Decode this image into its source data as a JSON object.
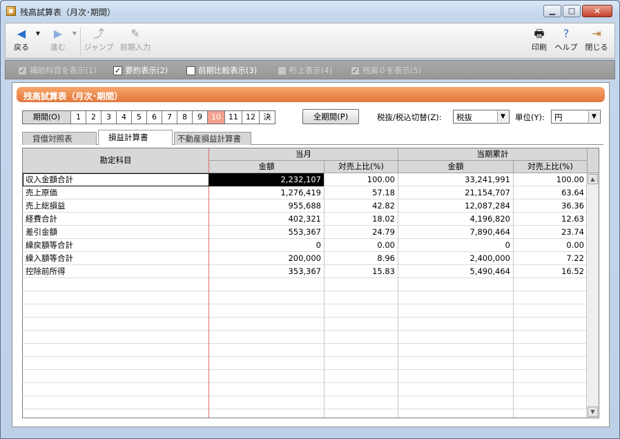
{
  "window": {
    "title": "残高試算表（月次･期間）"
  },
  "toolbar": {
    "back": "戻る",
    "forward": "進む",
    "jump": "ジャンプ",
    "prev_input": "前期入力",
    "print": "印刷",
    "help": "ヘルプ",
    "close": "閉じる"
  },
  "options": [
    {
      "label": "補助科目を表示(1)",
      "checked": true,
      "enabled": false
    },
    {
      "label": "要約表示(2)",
      "checked": true,
      "enabled": true
    },
    {
      "label": "前期比較表示(3)",
      "checked": false,
      "enabled": true
    },
    {
      "label": "桁上表示(4)",
      "checked": false,
      "enabled": false
    },
    {
      "label": "残高０を表示(5)",
      "checked": true,
      "enabled": false
    }
  ],
  "panel": {
    "header": "残高試算表（月次･期間）",
    "period_label": "期間(O)",
    "periods": [
      "1",
      "2",
      "3",
      "4",
      "5",
      "6",
      "7",
      "8",
      "9",
      "10",
      "11",
      "12",
      "決"
    ],
    "active_period": "10",
    "all_period_button": "全期間(P)",
    "tax_label": "税抜/税込切替(Z):",
    "tax_value": "税抜",
    "unit_label": "単位(Y):",
    "unit_value": "円"
  },
  "tabs": [
    {
      "label": "貸借対照表",
      "active": false
    },
    {
      "label": "損益計算書",
      "active": true
    },
    {
      "label": "不動産損益計算書",
      "active": false
    }
  ],
  "table": {
    "col_account": "勘定科目",
    "group_month": "当月",
    "group_cumulative": "当期累計",
    "col_amount": "金額",
    "col_ratio": "対売上比(%)",
    "rows": [
      {
        "account": "収入金額合計",
        "m_amount": "2,232,107",
        "m_ratio": "100.00",
        "c_amount": "33,241,991",
        "c_ratio": "100.00"
      },
      {
        "account": "売上原価",
        "m_amount": "1,276,419",
        "m_ratio": "57.18",
        "c_amount": "21,154,707",
        "c_ratio": "63.64"
      },
      {
        "account": "売上総損益",
        "m_amount": "955,688",
        "m_ratio": "42.82",
        "c_amount": "12,087,284",
        "c_ratio": "36.36"
      },
      {
        "account": "経費合計",
        "m_amount": "402,321",
        "m_ratio": "18.02",
        "c_amount": "4,196,820",
        "c_ratio": "12.63"
      },
      {
        "account": "差引金額",
        "m_amount": "553,367",
        "m_ratio": "24.79",
        "c_amount": "7,890,464",
        "c_ratio": "23.74"
      },
      {
        "account": "繰戻額等合計",
        "m_amount": "0",
        "m_ratio": "0.00",
        "c_amount": "0",
        "c_ratio": "0.00"
      },
      {
        "account": "繰入額等合計",
        "m_amount": "200,000",
        "m_ratio": "8.96",
        "c_amount": "2,400,000",
        "c_ratio": "7.22"
      },
      {
        "account": "控除前所得",
        "m_amount": "353,367",
        "m_ratio": "15.83",
        "c_amount": "5,490,464",
        "c_ratio": "16.52"
      }
    ]
  }
}
